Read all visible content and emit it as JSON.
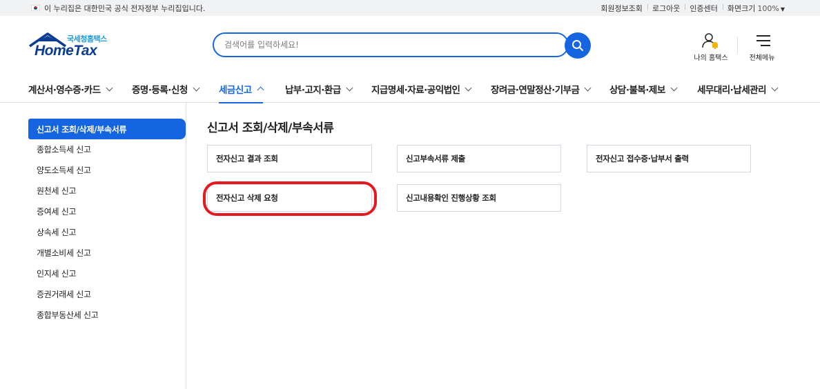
{
  "gov_bar": {
    "notice": "이 누리집은 대한민국 공식 전자정부 누리집입니다.",
    "links": [
      "회원정보조회",
      "로그아웃",
      "인증센터",
      "화면크기"
    ],
    "zoom_value": "100%"
  },
  "logo": {
    "sub": "국세청홈택스",
    "main": "HomeTax"
  },
  "search": {
    "placeholder": "검색어를 입력하세요!",
    "value": ""
  },
  "header_actions": {
    "my_home": "나의 홈택스",
    "all_menu": "전체메뉴"
  },
  "gnb": [
    {
      "label": "계산서·영수증·카드",
      "active": false
    },
    {
      "label": "증명·등록·신청",
      "active": false
    },
    {
      "label": "세금신고",
      "active": true
    },
    {
      "label": "납부·고지·환급",
      "active": false
    },
    {
      "label": "지급명세·자료·공익법인",
      "active": false
    },
    {
      "label": "장려금·연말정산·기부금",
      "active": false
    },
    {
      "label": "상담·불복·제보",
      "active": false
    },
    {
      "label": "세무대리·납세관리",
      "active": false
    }
  ],
  "sidebar": {
    "items": [
      {
        "label": "신고서 조회/삭제/부속서류",
        "active": true
      },
      {
        "label": "종합소득세 신고",
        "active": false
      },
      {
        "label": "양도소득세 신고",
        "active": false
      },
      {
        "label": "원천세 신고",
        "active": false
      },
      {
        "label": "증여세 신고",
        "active": false
      },
      {
        "label": "상속세 신고",
        "active": false
      },
      {
        "label": "개별소비세 신고",
        "active": false
      },
      {
        "label": "인지세 신고",
        "active": false
      },
      {
        "label": "증권거래세 신고",
        "active": false
      },
      {
        "label": "종합부동산세 신고",
        "active": false
      }
    ]
  },
  "main": {
    "title": "신고서 조회/삭제/부속서류",
    "cards": [
      "전자신고 결과 조회",
      "신고부속서류 제출",
      "전자신고 접수증·납부서 출력",
      "전자신고 삭제 요청",
      "신고내용확인 진행상황 조회"
    ]
  },
  "colors": {
    "accent": "#1565e0",
    "highlight": "#e4181e",
    "logo": "#0a3d91"
  }
}
